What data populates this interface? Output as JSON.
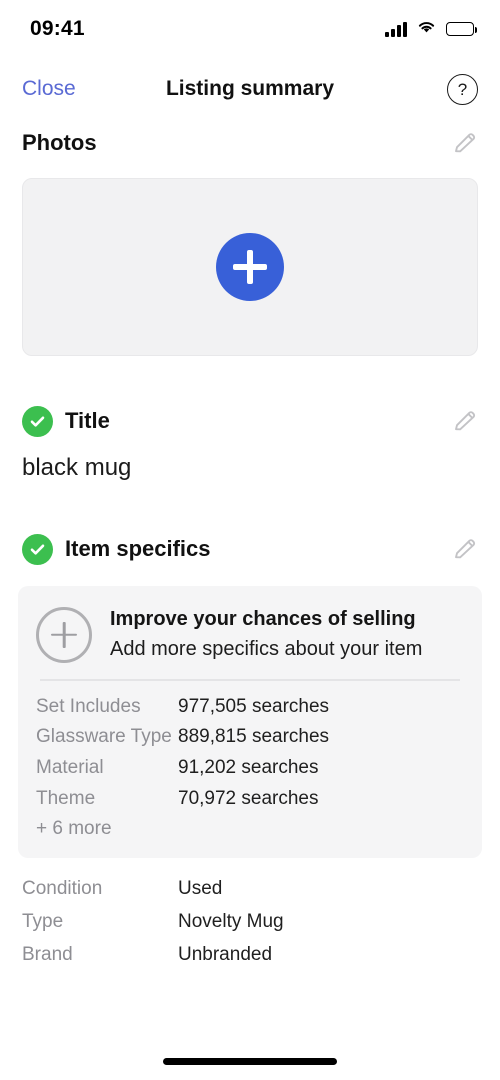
{
  "status_bar": {
    "time": "09:41",
    "signal_icon": "cellular-bars-icon",
    "wifi_icon": "wifi-icon",
    "battery_icon": "battery-full-icon"
  },
  "nav": {
    "close_label": "Close",
    "title": "Listing summary",
    "help_label": "?"
  },
  "photos": {
    "heading": "Photos",
    "edit_icon": "pencil-icon",
    "add_icon": "plus-icon"
  },
  "title_section": {
    "heading": "Title",
    "status_icon": "check-circle-icon",
    "edit_icon": "pencil-icon",
    "value": "black mug"
  },
  "item_specifics": {
    "heading": "Item specifics",
    "status_icon": "check-circle-icon",
    "edit_icon": "pencil-icon",
    "improve_card": {
      "icon": "circle-plus-icon",
      "headline": "Improve your chances of selling",
      "subtitle": "Add more specifics about your item",
      "suggestions": [
        {
          "label": "Set Includes",
          "value": "977,505 searches"
        },
        {
          "label": "Glassware Type",
          "value": "889,815 searches"
        },
        {
          "label": "Material",
          "value": "91,202 searches"
        },
        {
          "label": "Theme",
          "value": "70,972 searches"
        }
      ],
      "more_label": "+ 6 more"
    },
    "details": [
      {
        "label": "Condition",
        "value": "Used"
      },
      {
        "label": "Type",
        "value": "Novelty Mug"
      },
      {
        "label": "Brand",
        "value": "Unbranded"
      }
    ]
  },
  "colors": {
    "accent_blue": "#3860d8",
    "link_blue": "#5a6ad4",
    "success_green": "#3cbf4f",
    "muted_gray": "#8e8e93",
    "card_bg": "#f5f5f6"
  }
}
